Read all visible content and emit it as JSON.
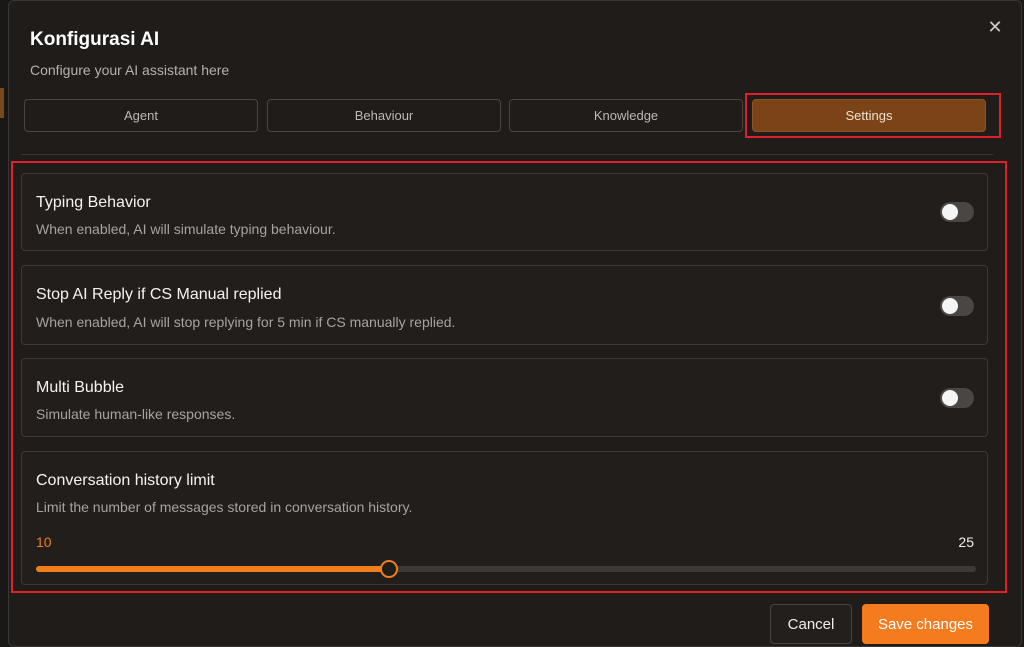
{
  "dialog": {
    "title": "Konfigurasi AI",
    "subtitle": "Configure your AI assistant here",
    "close_icon": "close-icon"
  },
  "tabs": [
    {
      "label": "Agent",
      "active": false
    },
    {
      "label": "Behaviour",
      "active": false
    },
    {
      "label": "Knowledge",
      "active": false
    },
    {
      "label": "Settings",
      "active": true
    }
  ],
  "settings": {
    "typing": {
      "title": "Typing Behavior",
      "description": "When enabled, AI will simulate typing behaviour.",
      "enabled": false
    },
    "stop_reply": {
      "title": "Stop AI Reply if CS Manual replied",
      "description": "When enabled, AI will stop replying for 5 min if CS manually replied.",
      "enabled": false
    },
    "multi_bubble": {
      "title": "Multi Bubble",
      "description": "Simulate human-like responses.",
      "enabled": false
    },
    "history_limit": {
      "title": "Conversation history limit",
      "description": "Limit the number of messages stored in conversation history.",
      "value": "10",
      "max_label": "25",
      "fill_fraction": 0.376
    }
  },
  "footer": {
    "cancel_label": "Cancel",
    "save_label": "Save changes"
  },
  "colors": {
    "accent": "#f47c1f",
    "active_tab": "#7a4418",
    "highlight": "#e0202a",
    "background": "#1f1c1a"
  }
}
